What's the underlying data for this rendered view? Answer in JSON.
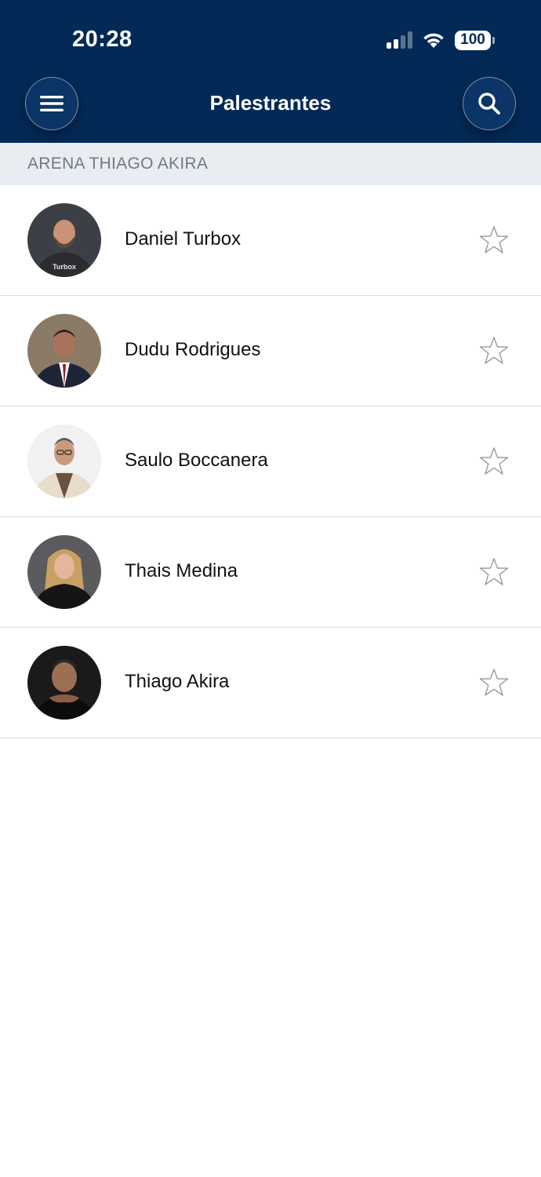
{
  "status_bar": {
    "time": "20:28",
    "battery": "100"
  },
  "nav": {
    "title": "Palestrantes",
    "left_icon": "menu-icon",
    "right_icon": "search-icon"
  },
  "section": {
    "label": "ARENA THIAGO AKIRA"
  },
  "speakers": [
    {
      "name": "Daniel Turbox",
      "favorite": false
    },
    {
      "name": "Dudu Rodrigues",
      "favorite": false
    },
    {
      "name": "Saulo Boccanera",
      "favorite": false
    },
    {
      "name": "Thais Medina",
      "favorite": false
    },
    {
      "name": "Thiago Akira",
      "favorite": false
    }
  ],
  "colors": {
    "header_bg": "#032a56",
    "section_bg": "#e9edf1",
    "section_text": "#6e7b86",
    "divider": "#d7dbdf"
  }
}
